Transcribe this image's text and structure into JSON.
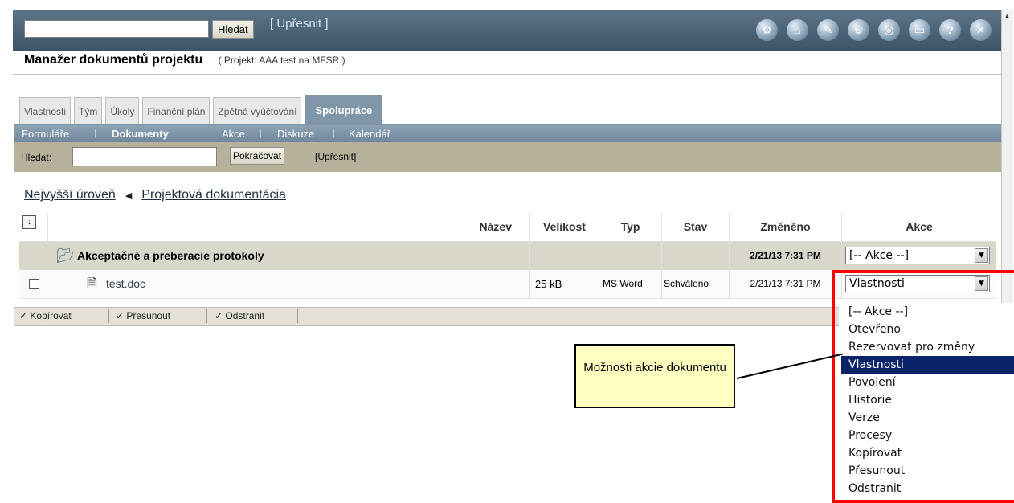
{
  "top": {
    "search_button": "Hledat",
    "refine_link": "[ Upřesnit ]",
    "icons": [
      "wrench-icon",
      "home-icon",
      "home-edit-icon",
      "settings-icon",
      "database-icon",
      "window-icon",
      "help-icon",
      "close-icon"
    ]
  },
  "header": {
    "title": "Manažer dokumentů projektu",
    "project": "( Projekt: AAA test na MFSR )"
  },
  "tabs": [
    {
      "label": "Vlastnosti"
    },
    {
      "label": "Tým"
    },
    {
      "label": "Úkoly"
    },
    {
      "label": "Finanční plán"
    },
    {
      "label": "Zpětná vyúčtování"
    },
    {
      "label": "Spolupráce",
      "active": true
    }
  ],
  "subnav": [
    {
      "label": "Formuláře"
    },
    {
      "label": "Dokumenty",
      "active": true
    },
    {
      "label": "Akce"
    },
    {
      "label": "Diskuze"
    },
    {
      "label": "Kalendář"
    }
  ],
  "filter": {
    "label": "Hledat:",
    "button": "Pokračovat",
    "refine": "[Upřesnit]"
  },
  "breadcrumb": {
    "root": "Nejvyšší úroveň",
    "current": "Projektová dokumentácia"
  },
  "table": {
    "headers": {
      "name": "Název",
      "size": "Velikost",
      "type": "Typ",
      "status": "Stav",
      "modified": "Změněno",
      "actions": "Akce"
    },
    "folder": {
      "name": "Akceptačné a preberacie protokoly",
      "modified": "2/21/13 7:31 PM",
      "action": "[-- Akce --]"
    },
    "file": {
      "name": "test.doc",
      "size": "25 kB",
      "type": "MS Word",
      "status": "Schváleno",
      "modified": "2/21/13 7:31 PM",
      "action": "Vlastnosti"
    }
  },
  "bulk_actions": {
    "copy": "✓ Kopírovat",
    "move": "✓ Přesunout",
    "delete": "✓ Odstranit"
  },
  "dropdown": {
    "options": [
      "[-- Akce --]",
      "Otevřeno",
      "Rezervovat pro změny",
      "Vlastnosti",
      "Povolení",
      "Historie",
      "Verze",
      "Procesy",
      "Kopírovat",
      "Přesunout",
      "Odstranit"
    ],
    "selected": "Vlastnosti"
  },
  "callout": {
    "text": "Možnosti akcie dokumentu"
  },
  "colors": {
    "topbar": "#4a6176",
    "active_tab": "#7f95a8",
    "filterbar": "#b6b19b",
    "folder_row": "#d9d7c9",
    "highlight": "#ff0000",
    "selected_option": "#0a246a",
    "callout_bg": "#ffffc0"
  }
}
